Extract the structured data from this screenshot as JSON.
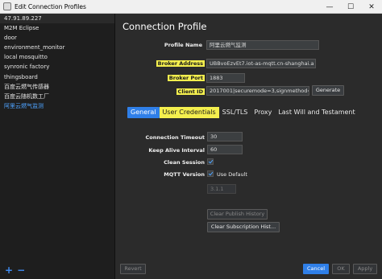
{
  "window": {
    "title": "Edit Connection Profiles",
    "controls": [
      "—",
      "☐",
      "✕"
    ]
  },
  "sidebar": {
    "items": [
      "47.91.89.227",
      "M2M Eclipse",
      "door",
      "environment_monitor",
      "local mosquitto",
      "synronic factory",
      "thingsboard",
      "百度云燃气传感器",
      "百度云随机数工厂",
      "阿里云燃气监测"
    ],
    "add_label": "+",
    "remove_label": "−"
  },
  "main": {
    "heading": "Connection Profile",
    "profile_name_label": "Profile Name",
    "profile_name_value": "阿里云燃气监测",
    "broker_address_label": "Broker Address",
    "broker_address_value": "UBBvoEzvEt7.iot-as-mqtt.cn-shanghai.a",
    "broker_port_label": "Broker Port",
    "broker_port_value": "1883",
    "client_id_label": "Client ID",
    "client_id_value": "2017001|securemode=3,signmethod=h",
    "generate_label": "Generate"
  },
  "tabs": [
    "General",
    "User Credentials",
    "SSL/TLS",
    "Proxy",
    "Last Will and Testament"
  ],
  "general": {
    "connection_timeout_label": "Connection Timeout",
    "connection_timeout_value": "30",
    "keep_alive_label": "Keep Alive Interval",
    "keep_alive_value": "60",
    "clean_session_label": "Clean Session",
    "mqtt_version_label": "MQTT Version",
    "use_default_label": "Use Default",
    "version_value": "3.1.1",
    "clear_publish_label": "Clear Publish History",
    "clear_subscription_label": "Clear Subscription Hist..."
  },
  "footer": {
    "revert_label": "Revert",
    "cancel_label": "Cancel",
    "ok_label": "OK",
    "apply_label": "Apply"
  }
}
